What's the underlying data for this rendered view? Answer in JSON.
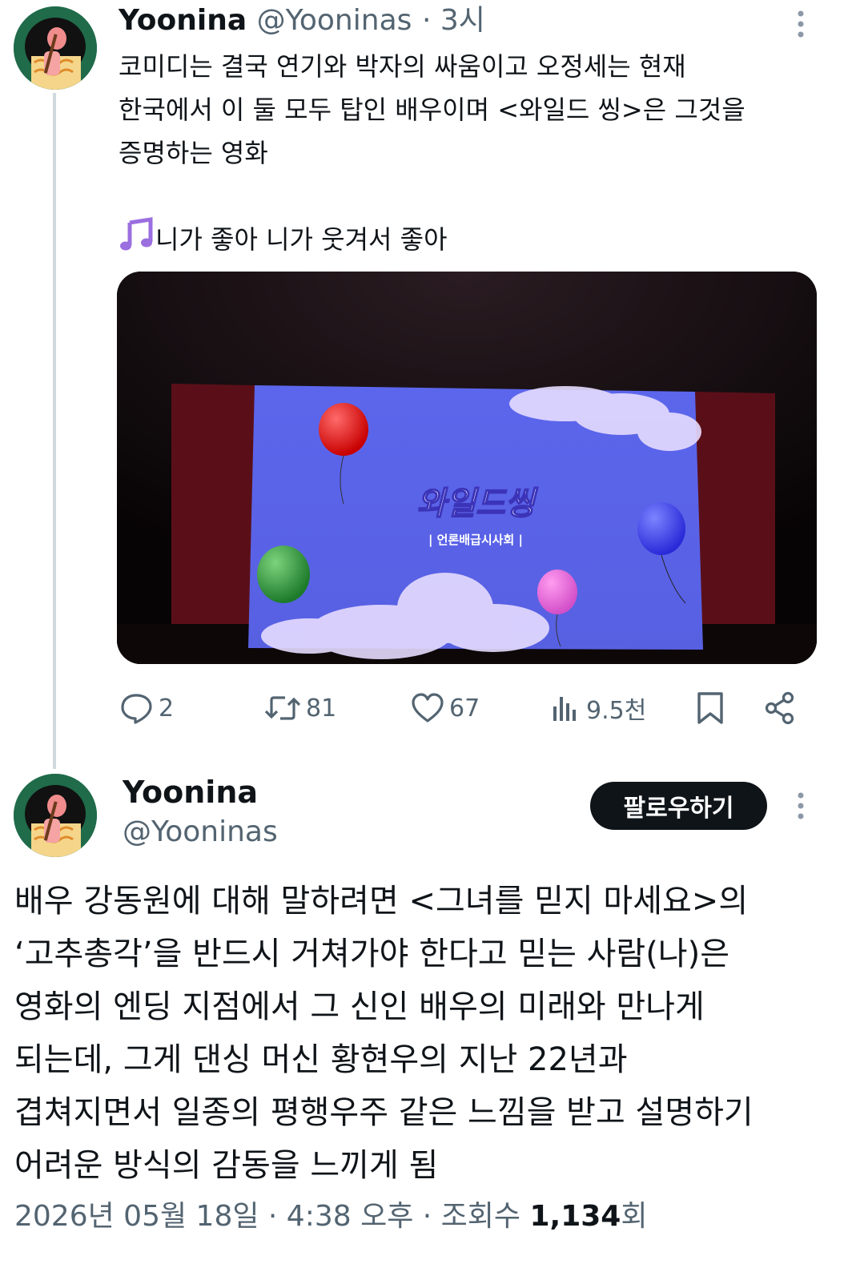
{
  "thread_tweet": {
    "display_name": "Yoonina",
    "handle": "@Yooninas",
    "time": "· 3시",
    "text": "코미디는 결국 연기와 박자의 싸움이고 오정세는 현재\n한국에서 이 둘 모두 탑인 배우이며 <와일드 씽>은 그것을\n증명하는 영화",
    "music_line": "니가 좋아 니가 웃겨서 좋아",
    "image": {
      "title": "와일드씽",
      "subtitle": "| 언론배급시사회 |"
    },
    "actions": {
      "replies": "2",
      "retweets": "81",
      "likes": "67",
      "views": "9.5천"
    }
  },
  "main_tweet": {
    "display_name": "Yoonina",
    "handle": "@Yooninas",
    "follow_label": "팔로우하기",
    "text": "배우 강동원에 대해 말하려면 <그녀를 믿지 마세요>의\n‘고추총각’을 반드시 거쳐가야 한다고 믿는 사람(나)은\n영화의 엔딩 지점에서 그 신인 배우의 미래와 만나게\n되는데, 그게 댄싱 머신 황현우의 지난 22년과\n겹쳐지면서 일종의 평행우주 같은 느낌을 받고 설명하기\n어려운 방식의 감동을 느끼게 됨",
    "meta_date": "2026년 05월 18일 · 4:38 오후 · 조회수 ",
    "meta_views": "1,134",
    "meta_unit": "회"
  },
  "colors": {
    "text": "#0f1419",
    "secondary": "#536471",
    "follow_bg": "#0f1419",
    "screen_blue": "#5a63e6"
  }
}
